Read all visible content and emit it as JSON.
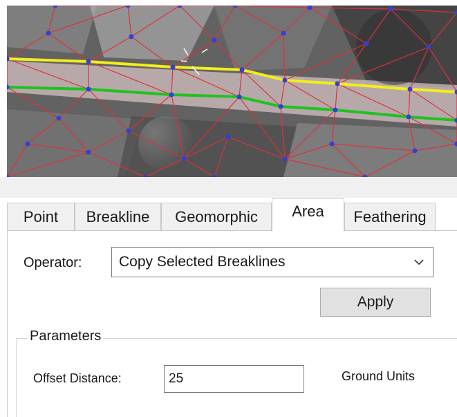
{
  "tabs": [
    {
      "label": "Point",
      "active": false
    },
    {
      "label": "Breakline",
      "active": false
    },
    {
      "label": "Geomorphic",
      "active": false
    },
    {
      "label": "Area",
      "active": true
    },
    {
      "label": "Feathering",
      "active": false
    }
  ],
  "operator": {
    "label": "Operator:",
    "selected": "Copy Selected Breaklines"
  },
  "apply": {
    "label": "Apply"
  },
  "parameters": {
    "title": "Parameters",
    "offset_label": "Offset Distance:",
    "offset_value": "25",
    "units_label": "Ground Units"
  },
  "viewport": {
    "edge_color": "#e0303a",
    "vertex_color": "#3040d8",
    "selected_breakline_color": "#f2ee1c",
    "copied_breakline_color": "#1fc21f"
  }
}
